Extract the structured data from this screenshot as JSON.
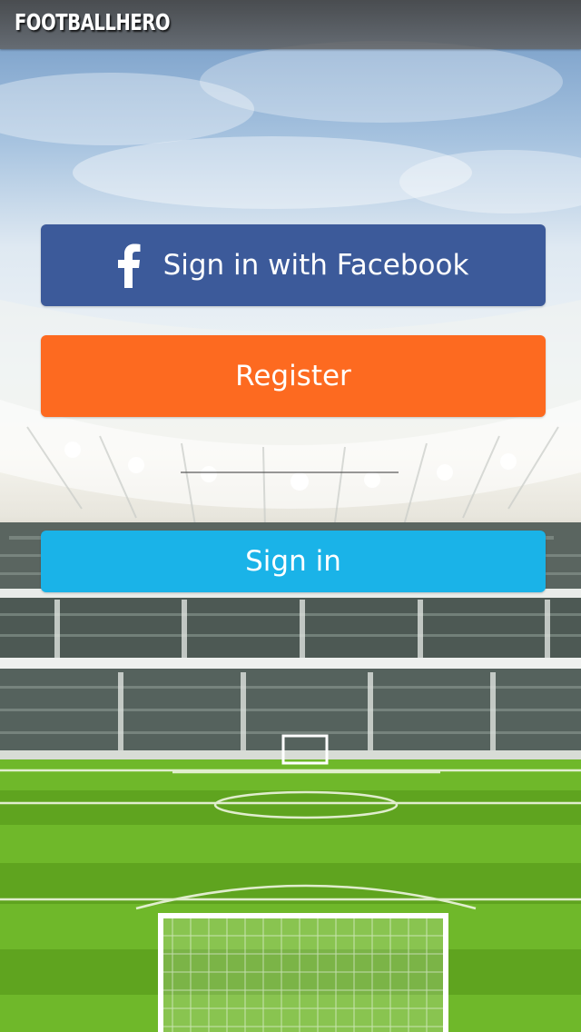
{
  "app": {
    "logo_text": "FOOTBALLHERO"
  },
  "buttons": {
    "facebook_label": "Sign in with Facebook",
    "register_label": "Register",
    "signin_label": "Sign in"
  },
  "icons": {
    "facebook": "facebook-icon"
  },
  "colors": {
    "facebook": "#3c5a9a",
    "register": "#fd6a20",
    "signin": "#1ab3e8",
    "topbar": "#4a4a4a",
    "pitch": "#6fb82a"
  }
}
